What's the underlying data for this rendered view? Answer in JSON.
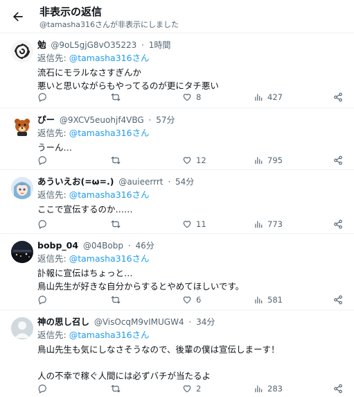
{
  "header": {
    "title": "非表示の返信",
    "subtitle": "@tamasha316さんが非表示にしました"
  },
  "reply_prefix": "返信先:",
  "reply_to": "@tamasha316さん",
  "tweets": [
    {
      "name": "勉",
      "handle": "@9oL5gjG8vO35223",
      "sep": "·",
      "time": "1時間",
      "lines": [
        "流石にモラルなさすぎんか",
        "悪いと思いながらもやってるのが更にタチ悪い"
      ],
      "replies": "",
      "retweets": "",
      "likes": "8",
      "views": "427",
      "avatar": "spiral-avatar"
    },
    {
      "name": "ぴー",
      "handle": "@9XCV5euohjf4VBG",
      "sep": "·",
      "time": "57分",
      "lines": [
        "うーん…"
      ],
      "replies": "",
      "retweets": "",
      "likes": "12",
      "views": "795",
      "avatar": "bear-avatar"
    },
    {
      "name": "あういえお(=ω=.)",
      "handle": "@auieerrrt",
      "sep": "·",
      "time": "54分",
      "lines": [
        "ここで宣伝するのか……"
      ],
      "replies": "",
      "retweets": "",
      "likes": "11",
      "views": "773",
      "avatar": "anime-avatar"
    },
    {
      "name": "bobp_04",
      "handle": "@04Bobp",
      "sep": "·",
      "time": "46分",
      "lines": [
        "訃報に宣伝はちょっと…",
        "鳥山先生が好きな自分からするとやめてほしいです。"
      ],
      "replies": "",
      "retweets": "",
      "likes": "6",
      "views": "581",
      "avatar": "night-avatar"
    },
    {
      "name": "神の思し召し",
      "handle": "@VisOcqM9vIMUGW4",
      "sep": "·",
      "time": "34分",
      "lines": [
        "鳥山先生も気にしなさそうなので、後輩の僕は宣伝しまーす！",
        "",
        "人の不幸で稼ぐ人間には必ずバチが当たるよ"
      ],
      "replies": "",
      "retweets": "",
      "likes": "2",
      "views": "283",
      "avatar": "default-avatar"
    }
  ]
}
